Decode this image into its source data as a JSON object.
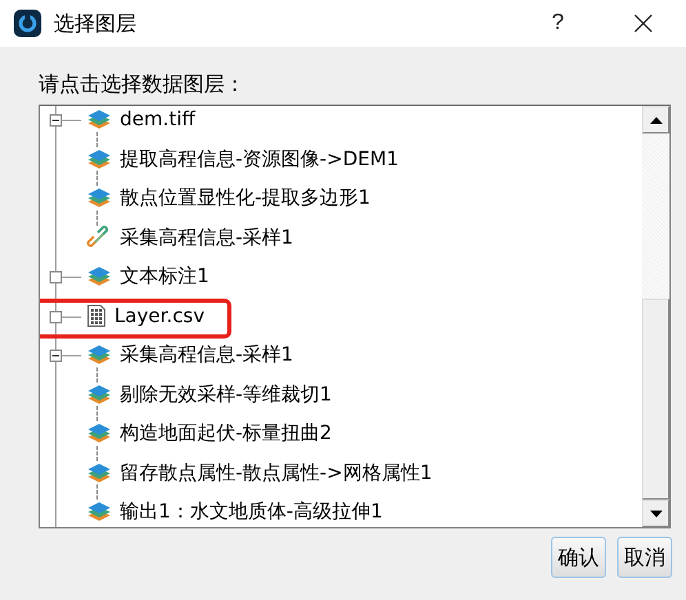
{
  "window": {
    "title": "选择图层",
    "help": "?"
  },
  "prompt": "请点击选择数据图层：",
  "tree": [
    {
      "label": "dem.tiff",
      "kind": "layer",
      "expanded": true,
      "highlighted": false,
      "children": [
        {
          "label": "提取高程信息-资源图像->DEM1",
          "kind": "layer"
        },
        {
          "label": "散点位置显性化-提取多边形1",
          "kind": "layer"
        },
        {
          "label": "采集高程信息-采样1",
          "kind": "link"
        }
      ]
    },
    {
      "label": "文本标注1",
      "kind": "layer",
      "expanded": false,
      "highlighted": false
    },
    {
      "label": "Layer.csv",
      "kind": "table",
      "expanded": false,
      "highlighted": true
    },
    {
      "label": "采集高程信息-采样1",
      "kind": "layer",
      "expanded": true,
      "highlighted": false,
      "children": [
        {
          "label": "剔除无效采样-等维裁切1",
          "kind": "layer"
        },
        {
          "label": "构造地面起伏-标量扭曲2",
          "kind": "layer"
        },
        {
          "label": "留存散点属性-散点属性->网格属性1",
          "kind": "layer"
        },
        {
          "label": "输出1：水文地质体-高级拉伸1",
          "kind": "layer"
        }
      ]
    }
  ],
  "buttons": [
    "确认",
    "取消"
  ]
}
